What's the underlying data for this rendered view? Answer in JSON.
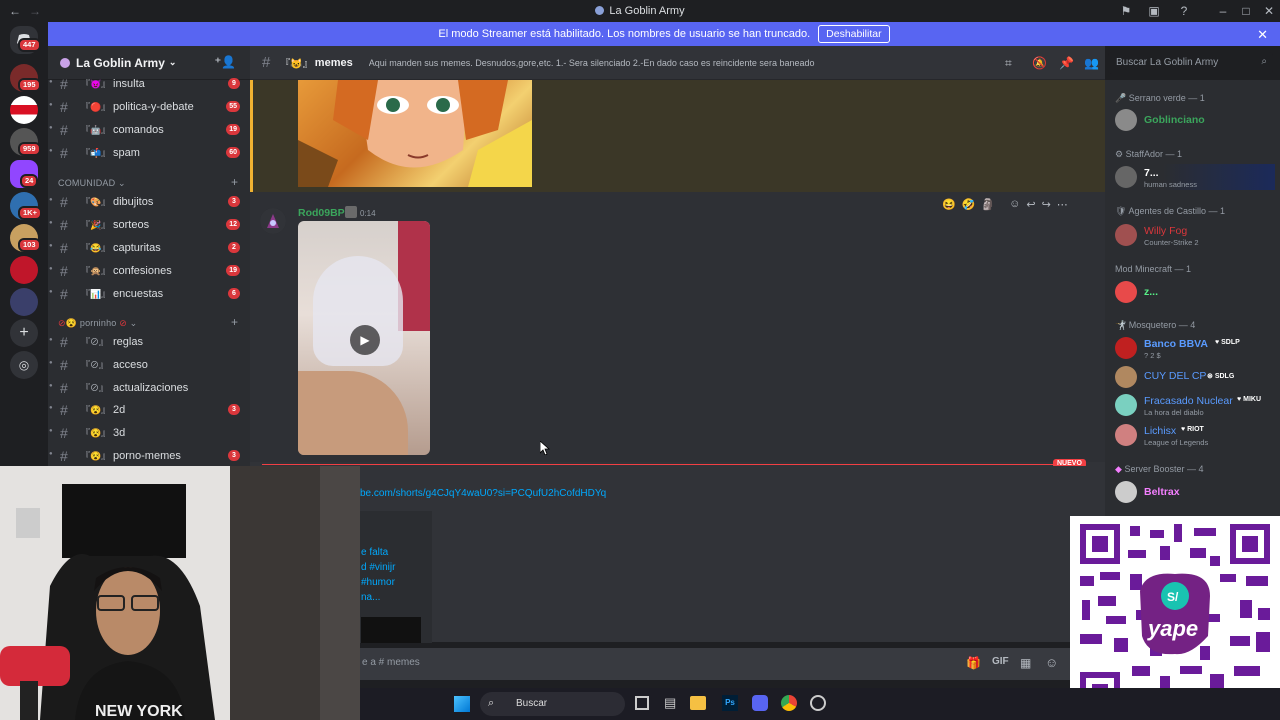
{
  "window": {
    "title": "La Goblin Army"
  },
  "banner": {
    "text": "El modo Streamer está habilitado. Los nombres de usuario se han truncado.",
    "button": "Deshabilitar"
  },
  "rail": {
    "badges": [
      "447",
      "195",
      "959",
      "24",
      "1K+",
      "103"
    ]
  },
  "server": {
    "name": "La Goblin Army"
  },
  "channels_top": [
    {
      "name": "insulta",
      "count": "9"
    },
    {
      "name": "politica-y-debate",
      "count": "55"
    },
    {
      "name": "comandos",
      "count": "19"
    },
    {
      "name": "spam",
      "count": "60"
    }
  ],
  "category_comunidad": "COMUNIDAD",
  "channels_comunidad": [
    {
      "name": "dibujitos",
      "count": "3"
    },
    {
      "name": "sorteos",
      "count": "12"
    },
    {
      "name": "capturitas",
      "count": "2"
    },
    {
      "name": "confesiones",
      "count": "19"
    },
    {
      "name": "encuestas",
      "count": "6"
    }
  ],
  "category_porninho": "porninho",
  "channels_porninho": [
    {
      "name": "reglas",
      "count": ""
    },
    {
      "name": "acceso",
      "count": ""
    },
    {
      "name": "actualizaciones",
      "count": ""
    },
    {
      "name": "2d",
      "count": "3"
    },
    {
      "name": "3d",
      "count": ""
    },
    {
      "name": "porno-memes",
      "count": "3"
    }
  ],
  "channel": {
    "name": "memes",
    "topic": "Aqui manden sus memes. Desnudos,gore,etc. 1.- Sera silenciado 2.-En dado caso es reincidente sera baneado"
  },
  "search": {
    "placeholder": "Buscar La Goblin Army"
  },
  "message": {
    "author": "Rod09BP",
    "time": "0:14"
  },
  "new_label": "NUEVO",
  "link_text": "be.com/shorts/g4CJqY4waU0?si=PCQufU2hCofdHDYq",
  "embed_lines": [
    "e falta",
    "d #vinijr",
    "#humor",
    "na..."
  ],
  "composer": {
    "placeholder": "e a # memes"
  },
  "members": [
    {
      "group": "Serrano verde — 1",
      "items": [
        {
          "name": "Goblinciano",
          "status": "",
          "tag": "",
          "color": "#3ba55c"
        }
      ]
    },
    {
      "group": "StaffAdor — 1",
      "items": [
        {
          "name": "7...",
          "status": "human sadness",
          "tag": "",
          "color": "#ffffff"
        }
      ]
    },
    {
      "group": "Agentes de Castillo — 1",
      "items": [
        {
          "name": "Willy Fog",
          "status": "Counter-Strike 2",
          "tag": "",
          "color": "#da373c"
        }
      ]
    },
    {
      "group": "Mod Minecraft — 1",
      "items": [
        {
          "name": "z...",
          "status": "",
          "tag": "",
          "color": "#57f287"
        }
      ]
    },
    {
      "group": "Mosquetero — 4",
      "items": [
        {
          "name": "Banco BBVA",
          "status": "? 2 $",
          "tag": "SDLP",
          "color": "#5a9bff"
        },
        {
          "name": "CUY DEL CP",
          "status": "",
          "tag": "SDLG",
          "color": "#5a9bff"
        },
        {
          "name": "Fracasado Nuclear",
          "status": "La hora del diablo",
          "tag": "MIKU",
          "color": "#5a9bff"
        },
        {
          "name": "Lichisx",
          "status": "League of Legends",
          "tag": "RIOT",
          "color": "#5a9bff"
        }
      ]
    },
    {
      "group": "Server Booster — 4",
      "items": [
        {
          "name": "Beltrax",
          "status": "",
          "tag": "",
          "color": "#f47fff"
        }
      ]
    }
  ],
  "taskbar": {
    "search": "Buscar"
  }
}
